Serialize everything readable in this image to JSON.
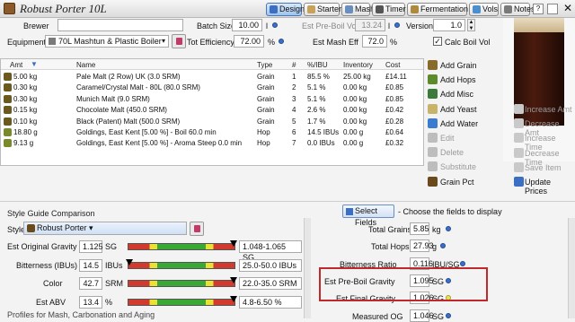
{
  "window": {
    "title": "Robust Porter 10L"
  },
  "tabs": [
    {
      "label": "Design",
      "active": true,
      "color": "#3c6ec4"
    },
    {
      "label": "Starter",
      "active": false,
      "color": "#c8a25a"
    },
    {
      "label": "Mash",
      "active": false,
      "color": "#6a8fbf"
    },
    {
      "label": "Timer",
      "active": false,
      "color": "#555555"
    },
    {
      "label": "Fermentation",
      "active": false,
      "color": "#b08a3c"
    },
    {
      "label": "Vols",
      "active": false,
      "color": "#4a90d0"
    },
    {
      "label": "Notes",
      "active": false,
      "color": "#7a7a7a"
    }
  ],
  "form": {
    "brewer_label": "Brewer",
    "equipment_label": "Equipment",
    "equipment_value": "70L Mashtun & Plastic Boiler",
    "batch_size_label": "Batch Size",
    "batch_size_value": "10.00",
    "batch_size_unit": "l",
    "est_preboil_label": "Est Pre-Boil Vol",
    "est_preboil_value": "13.24",
    "est_preboil_unit": "l",
    "version_label": "Version",
    "version_value": "1.0",
    "tot_eff_label": "Tot Efficiency",
    "tot_eff_value": "72.00",
    "tot_eff_unit": "%",
    "est_mash_eff_label": "Est Mash Eff",
    "est_mash_eff_value": "72.0",
    "est_mash_eff_unit": "%",
    "calc_boil_label": "Calc Boil Vol",
    "calc_boil_checked": true
  },
  "table": {
    "columns": [
      "Amt",
      "Name",
      "Type",
      "#",
      "%/IBU",
      "Inventory",
      "Cost"
    ],
    "rows": [
      {
        "amt": "5.00 kg",
        "name": "Pale Malt (2 Row) UK (3.0 SRM)",
        "type": "Grain",
        "num": "1",
        "pct": "85.5 %",
        "inv": "25.00 kg",
        "cost": "£14.11"
      },
      {
        "amt": "0.30 kg",
        "name": "Caramel/Crystal Malt - 80L (80.0 SRM)",
        "type": "Grain",
        "num": "2",
        "pct": "5.1 %",
        "inv": "0.00 kg",
        "cost": "£0.85"
      },
      {
        "amt": "0.30 kg",
        "name": "Munich Malt (9.0 SRM)",
        "type": "Grain",
        "num": "3",
        "pct": "5.1 %",
        "inv": "0.00 kg",
        "cost": "£0.85"
      },
      {
        "amt": "0.15 kg",
        "name": "Chocolate Malt (450.0 SRM)",
        "type": "Grain",
        "num": "4",
        "pct": "2.6 %",
        "inv": "0.00 kg",
        "cost": "£0.42"
      },
      {
        "amt": "0.10 kg",
        "name": "Black (Patent) Malt (500.0 SRM)",
        "type": "Grain",
        "num": "5",
        "pct": "1.7 %",
        "inv": "0.00 kg",
        "cost": "£0.28"
      },
      {
        "amt": "18.80 g",
        "name": "Goldings, East Kent [5.00 %] - Boil 60.0 min",
        "type": "Hop",
        "num": "6",
        "pct": "14.5 IBUs",
        "inv": "0.00 g",
        "cost": "£0.64"
      },
      {
        "amt": "9.13 g",
        "name": "Goldings, East Kent [5.00 %] - Aroma Steep 0.0 min",
        "type": "Hop",
        "num": "7",
        "pct": "0.0 IBUs",
        "inv": "0.00 g",
        "cost": "£0.32"
      }
    ]
  },
  "actions_left": [
    {
      "label": "Add Grain",
      "enabled": true,
      "color": "#8a6a2a"
    },
    {
      "label": "Add Hops",
      "enabled": true,
      "color": "#5d8a2a"
    },
    {
      "label": "Add Misc",
      "enabled": true,
      "color": "#3c7a3c"
    },
    {
      "label": "Add Yeast",
      "enabled": true,
      "color": "#c9b36a"
    },
    {
      "label": "Add Water",
      "enabled": true,
      "color": "#3c7ccf"
    },
    {
      "label": "Edit",
      "enabled": false,
      "color": "#bdbdbd"
    },
    {
      "label": "Delete",
      "enabled": false,
      "color": "#bdbdbd"
    },
    {
      "label": "Substitute",
      "enabled": false,
      "color": "#bdbdbd"
    },
    {
      "label": "Grain Pct",
      "enabled": true,
      "color": "#6a4a1a"
    }
  ],
  "actions_right": [
    {
      "label": "Increase Amt",
      "enabled": false
    },
    {
      "label": "Decrease Amt",
      "enabled": false
    },
    {
      "label": "Increase Time",
      "enabled": false
    },
    {
      "label": "Decrease Time",
      "enabled": false
    },
    {
      "label": "Save Item",
      "enabled": false
    },
    {
      "label": "Update Prices",
      "enabled": true
    }
  ],
  "style_guide": {
    "section_title": "Style Guide Comparison",
    "style_label": "Style",
    "style_value": "Robust Porter",
    "rows": [
      {
        "label": "Est Original Gravity",
        "value": "1.125",
        "unit": "SG",
        "range": "1.048-1.065 SG",
        "level": 0.98
      },
      {
        "label": "Bitterness (IBUs)",
        "value": "14.5",
        "unit": "IBUs",
        "range": "25.0-50.0 IBUs",
        "level": 0.02
      },
      {
        "label": "Color",
        "value": "42.7",
        "unit": "SRM",
        "range": "22.0-35.0 SRM",
        "level": 0.98
      },
      {
        "label": "Est ABV",
        "value": "13.4",
        "unit": "%",
        "range": "4.8-6.50 %",
        "level": 0.98
      }
    ],
    "bottom_label": "Profiles for Mash, Carbonation and Aging"
  },
  "fields": {
    "select_button": "Select Fields",
    "hint": "- Choose the fields to display",
    "items": [
      {
        "label": "Total Grains",
        "value": "5.85",
        "unit": "kg",
        "dot": "blue"
      },
      {
        "label": "Total Hops",
        "value": "27.93",
        "unit": "g",
        "dot": "blue"
      },
      {
        "label": "Bitterness Ratio",
        "value": "0.116",
        "unit": "IBU/SG",
        "dot": "blue"
      },
      {
        "label": "Est Pre-Boil Gravity",
        "value": "1.095",
        "unit": "SG",
        "dot": "blue"
      },
      {
        "label": "Est Final Gravity",
        "value": "1.026",
        "unit": "SG",
        "dot": "yellow"
      },
      {
        "label": "Measured OG",
        "value": "1.046",
        "unit": "SG",
        "dot": "blue"
      }
    ]
  },
  "colors": {
    "highlight": "#c0282c",
    "good": "#3aa834",
    "warn": "#e9e133",
    "bad": "#d33a2e"
  }
}
